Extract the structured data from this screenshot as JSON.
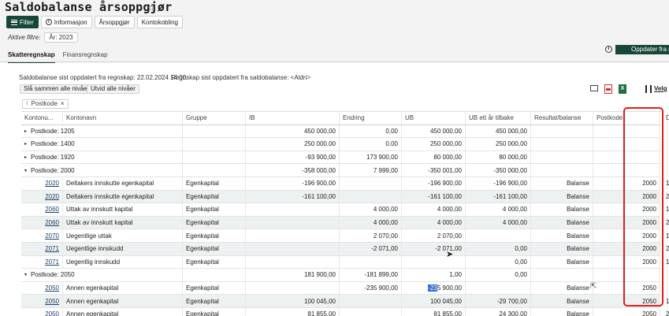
{
  "page": {
    "title": "Saldobalanse årsoppgjør",
    "favorite_icon": "star-outline-icon"
  },
  "toolbar": {
    "filter_label": "Filter",
    "info_label": "Informasjon",
    "arsoppgjor_label": "Årsoppgjør",
    "kontokobling_label": "Kontokobling"
  },
  "active_filters": {
    "label": "Aktive filtre:",
    "chip": "År: 2023"
  },
  "tabs": [
    {
      "label": "Skatteregnskap",
      "active": true
    },
    {
      "label": "Finansregnskap",
      "active": false
    }
  ],
  "update_button": "Oppdater fra re",
  "info": {
    "updated": "Saldobalanse sist oppdatert fra regnskap: 22.02.2024 14:00",
    "regnskap": "Regnskap sist oppdatert fra saldobalanse: <Aldri>"
  },
  "buttons": {
    "collapse": "Slå sammen alle nivåer",
    "expand": "Utvid alle nivåer",
    "velg": "Velg"
  },
  "group_chip": {
    "label": "Postkode",
    "remove": "×"
  },
  "columns": [
    "Kontonu...",
    "Kontonavn",
    "Gruppe",
    "IB",
    "Endring",
    "UB",
    "UB ett år tilbake",
    "Resultat/balanse",
    "Postkode",
    "",
    "Deltaker"
  ],
  "rows": [
    {
      "type": "group",
      "expanded": false,
      "label": "Postkode: 1205",
      "ib": "450 000,00",
      "endring": "0,00",
      "ub": "450 000,00",
      "ub_prev": "450 000,00"
    },
    {
      "type": "group",
      "expanded": false,
      "label": "Postkode: 1400",
      "ib": "250 000,00",
      "endring": "0,00",
      "ub": "250 000,00",
      "ub_prev": "250 000,00"
    },
    {
      "type": "group",
      "expanded": false,
      "label": "Postkode: 1920",
      "ib": "-93 900,00",
      "endring": "173 900,00",
      "ub": "80 000,00",
      "ub_prev": "80 000,00"
    },
    {
      "type": "group",
      "expanded": true,
      "label": "Postkode: 2000",
      "ib": "-358 000,00",
      "endring": "7 999,00",
      "ub": "-350 001,00",
      "ub_prev": "-350 000,00"
    },
    {
      "type": "item",
      "konto": "2020",
      "navn": "Deltakers innskutte egenkapital",
      "gruppe": "Egenkapital",
      "ib": "-196 900,00",
      "endring": "",
      "ub": "-196 900,00",
      "ub_prev": "-196 900,00",
      "rb": "Balanse",
      "postkode": "2000",
      "deltaker": "1"
    },
    {
      "type": "item",
      "konto": "2020",
      "navn": "Deltakers innskutte egenkapital",
      "gruppe": "Egenkapital",
      "ib": "-161 100,00",
      "endring": "",
      "ub": "-161 100,00",
      "ub_prev": "-161 100,00",
      "rb": "Balanse",
      "postkode": "2000",
      "deltaker": "2"
    },
    {
      "type": "item",
      "konto": "2060",
      "navn": "Uttak av innskutt kapital",
      "gruppe": "Egenkapital",
      "ib": "",
      "endring": "4 000,00",
      "ub": "4 000,00",
      "ub_prev": "4 000,00",
      "rb": "Balanse",
      "postkode": "2000",
      "deltaker": "1"
    },
    {
      "type": "item",
      "konto": "2060",
      "navn": "Uttak av innskutt kapital",
      "gruppe": "Egenkapital",
      "ib": "",
      "endring": "4 000,00",
      "ub": "4 000,00",
      "ub_prev": "4 000,00",
      "rb": "Balanse",
      "postkode": "2000",
      "deltaker": "2"
    },
    {
      "type": "item",
      "konto": "2070",
      "navn": "Uegentlige uttak",
      "gruppe": "Egenkapital",
      "ib": "",
      "endring": "2 070,00",
      "ub": "2 070,00",
      "ub_prev": "",
      "rb": "Balanse",
      "postkode": "2000",
      "deltaker": "1"
    },
    {
      "type": "item",
      "konto": "2071",
      "navn": "Uegentlige innskudd",
      "gruppe": "Egenkapital",
      "ib": "",
      "endring": "-2 071,00",
      "ub": "-2 071,00",
      "ub_prev": "0,00",
      "rb": "Balanse",
      "postkode": "2000",
      "deltaker": "2"
    },
    {
      "type": "item",
      "konto": "2071",
      "navn": "Uegentlig innskudd",
      "gruppe": "Egenkapital",
      "ib": "",
      "endring": "",
      "ub": "",
      "ub_prev": "0,00",
      "rb": "Balanse",
      "postkode": "2000",
      "deltaker": "1"
    },
    {
      "type": "group",
      "expanded": true,
      "label": "Postkode: 2050",
      "ib": "181 900,00",
      "endring": "-181 899,00",
      "ub": "1,00",
      "ub_prev": "0,00"
    },
    {
      "type": "item",
      "konto": "2050",
      "navn": "Annen egenkapital",
      "gruppe": "Egenkapital",
      "ib": "",
      "endring": "-235 900,00",
      "ub_hl": "-23",
      "ub_rest": "5 900,00",
      "ub_prev": "",
      "rb": "Balanse",
      "postkode": "2050",
      "deltaker": ""
    },
    {
      "type": "item",
      "konto": "2050",
      "navn": "Annen egenkapital",
      "gruppe": "Egenkapital",
      "ib": "100 045,00",
      "endring": "",
      "ub": "100 045,00",
      "ub_prev": "-29 700,00",
      "rb": "Balanse",
      "postkode": "2050",
      "deltaker": "1"
    },
    {
      "type": "item",
      "konto": "2050",
      "navn": "Annen egenkapital",
      "gruppe": "Egenkapital",
      "ib": "81 855,00",
      "endring": "",
      "ub": "81 855,00",
      "ub_prev": "24 300,00",
      "rb": "Balanse",
      "postkode": "2050",
      "deltaker": "2"
    }
  ]
}
